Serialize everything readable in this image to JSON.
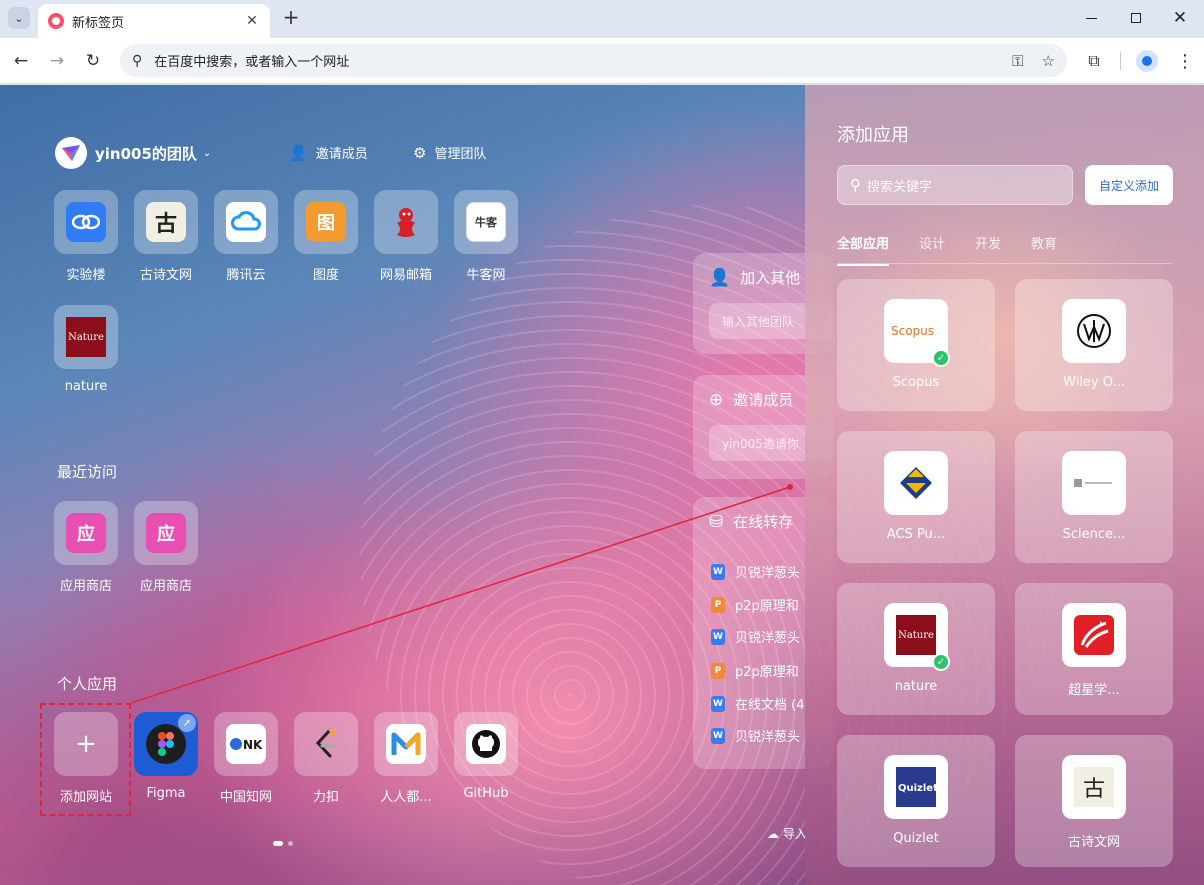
{
  "browser": {
    "tab_title": "新标签页",
    "omnibox_placeholder": "在百度中搜索，或者输入一个网址"
  },
  "team": {
    "name": "yin005的团队",
    "invite_label": "邀请成员",
    "manage_label": "管理团队"
  },
  "team_apps": [
    {
      "label": "实验楼",
      "icon": "shiyanlou-icon",
      "color": "#2f7cf6"
    },
    {
      "label": "古诗文网",
      "icon": "gushiwen-icon",
      "color": "#f1efe2"
    },
    {
      "label": "腾讯云",
      "icon": "tencent-cloud-icon",
      "color": "#ffffff"
    },
    {
      "label": "图度",
      "icon": "tudu-icon",
      "color": "#f49a2f"
    },
    {
      "label": "网易邮箱",
      "icon": "netease-mail-icon",
      "color": "#d81f26"
    },
    {
      "label": "牛客网",
      "icon": "nowcoder-icon",
      "color": "#ffffff"
    },
    {
      "label": "nature",
      "icon": "nature-icon",
      "color": "#8b0e1a"
    }
  ],
  "icon_glyphs": {
    "gushiwen": "古",
    "tudu": "图",
    "nowcoder": "牛客",
    "nature": "Nature",
    "yingyong": "应"
  },
  "recent": {
    "title": "最近访问",
    "apps": [
      {
        "label": "应用商店",
        "icon": "app-store-icon",
        "color": "#e84fb3"
      },
      {
        "label": "应用商店",
        "icon": "app-store-icon",
        "color": "#e84fb3"
      }
    ]
  },
  "personal": {
    "title": "个人应用",
    "add_label": "添加网站",
    "apps": [
      {
        "label": "Figma",
        "icon": "figma-icon"
      },
      {
        "label": "中国知网",
        "icon": "cnki-icon"
      },
      {
        "label": "力扣",
        "icon": "leetcode-icon"
      },
      {
        "label": "人人都...",
        "icon": "renrendou-icon"
      },
      {
        "label": "GitHub",
        "icon": "github-icon"
      }
    ]
  },
  "widgets": {
    "join": {
      "title": "加入其他",
      "placeholder": "输入其他团队"
    },
    "invite": {
      "title": "邀请成员",
      "placeholder": "yin005邀请你"
    },
    "transfer": {
      "title": "在线转存",
      "docs": [
        {
          "type": "W",
          "name": "贝锐洋葱头"
        },
        {
          "type": "P",
          "name": "p2p原理和"
        },
        {
          "type": "W",
          "name": "贝锐洋葱头"
        },
        {
          "type": "P",
          "name": "p2p原理和"
        },
        {
          "type": "W",
          "name": "在线文档 (4"
        },
        {
          "type": "W",
          "name": "贝锐洋葱头"
        }
      ],
      "import_label": "导入"
    }
  },
  "panel": {
    "title": "添加应用",
    "search_placeholder": "搜索关键字",
    "custom_add_label": "自定义添加",
    "tabs": [
      "全部应用",
      "设计",
      "开发",
      "教育"
    ],
    "cards": [
      {
        "label": "Scopus",
        "icon": "scopus-icon",
        "added": true
      },
      {
        "label": "Wiley O...",
        "icon": "wiley-icon",
        "added": false
      },
      {
        "label": "ACS Pu...",
        "icon": "acs-icon",
        "added": false
      },
      {
        "label": "Science...",
        "icon": "science-icon",
        "added": false
      },
      {
        "label": "nature",
        "icon": "nature-icon",
        "added": true
      },
      {
        "label": "超星学...",
        "icon": "chaoxing-icon",
        "added": false
      },
      {
        "label": "Quizlet",
        "icon": "quizlet-icon",
        "added": false
      },
      {
        "label": "古诗文网",
        "icon": "gushiwen-icon",
        "added": false
      }
    ]
  },
  "accent_color": "#e0263a"
}
